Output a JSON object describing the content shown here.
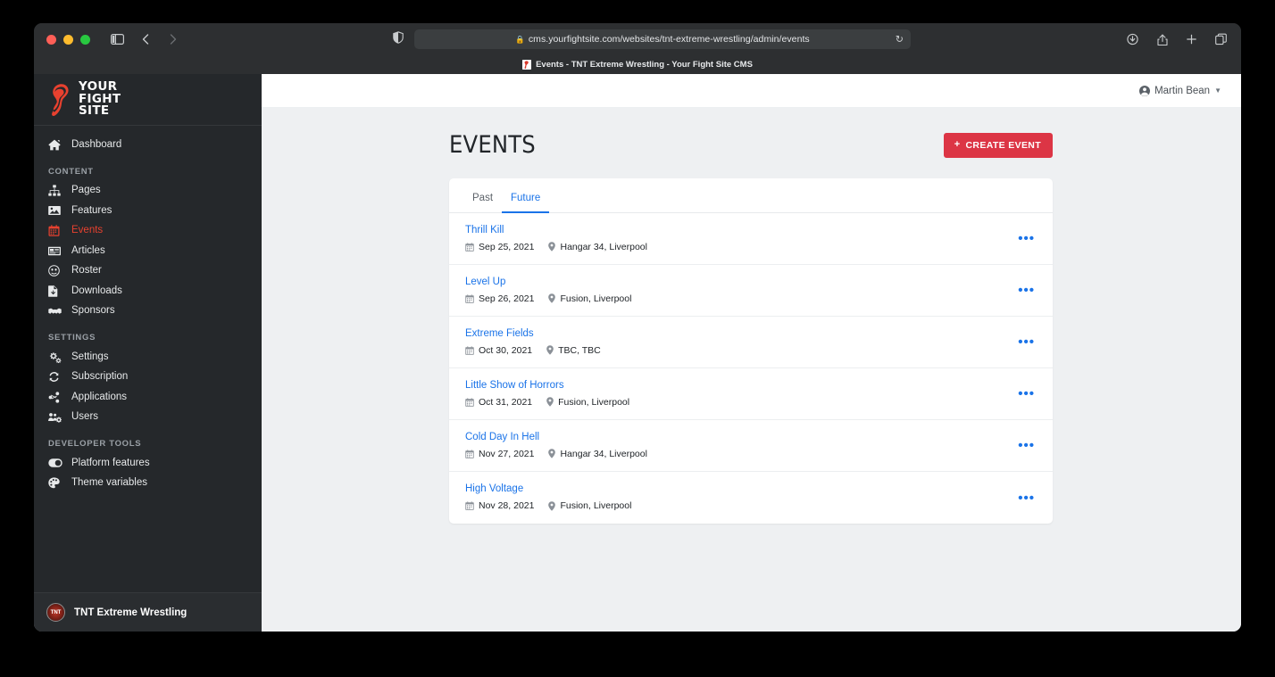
{
  "browser": {
    "url": "cms.yourfightsite.com/websites/tnt-extreme-wrestling/admin/events",
    "tab_title": "Events - TNT Extreme Wrestling - Your Fight Site CMS",
    "lock_icon": "lock-icon",
    "reload_icon": "reload-icon",
    "back_icon": "back-arrow-icon",
    "forward_icon": "forward-arrow-icon",
    "sidebar_icon": "sidebar-toggle-icon",
    "shield_icon": "shield-icon",
    "downloads_icon": "downloads-icon",
    "share_icon": "share-icon",
    "newtab_icon": "new-tab-icon",
    "tabs_icon": "tab-overview-icon"
  },
  "sidebar": {
    "brand": {
      "line1": "YOUR",
      "line2": "FIGHT",
      "line3": "SITE",
      "logo_icon": "fist-logo-icon"
    },
    "groups": [
      {
        "heading": null,
        "items": [
          {
            "label": "Dashboard",
            "icon": "home-icon",
            "active": false
          }
        ]
      },
      {
        "heading": "CONTENT",
        "items": [
          {
            "label": "Pages",
            "icon": "sitemap-icon",
            "active": false
          },
          {
            "label": "Features",
            "icon": "image-icon",
            "active": false
          },
          {
            "label": "Events",
            "icon": "calendar-icon",
            "active": true
          },
          {
            "label": "Articles",
            "icon": "newspaper-icon",
            "active": false
          },
          {
            "label": "Roster",
            "icon": "mask-icon",
            "active": false
          },
          {
            "label": "Downloads",
            "icon": "file-download-icon",
            "active": false
          },
          {
            "label": "Sponsors",
            "icon": "handshake-icon",
            "active": false
          }
        ]
      },
      {
        "heading": "SETTINGS",
        "items": [
          {
            "label": "Settings",
            "icon": "cogs-icon",
            "active": false
          },
          {
            "label": "Subscription",
            "icon": "sync-icon",
            "active": false
          },
          {
            "label": "Applications",
            "icon": "share-alt-icon",
            "active": false
          },
          {
            "label": "Users",
            "icon": "users-cog-icon",
            "active": false
          }
        ]
      },
      {
        "heading": "DEVELOPER TOOLS",
        "items": [
          {
            "label": "Platform features",
            "icon": "toggle-on-icon",
            "active": false
          },
          {
            "label": "Theme variables",
            "icon": "palette-icon",
            "active": false
          }
        ]
      }
    ],
    "footer": {
      "site_name": "TNT Extreme Wrestling",
      "avatar_text": "TNT",
      "avatar_icon": "tnt-logo-avatar"
    }
  },
  "topbar": {
    "user_name": "Martin Bean",
    "user_icon": "user-circle-icon",
    "caret_icon": "caret-down-icon"
  },
  "page": {
    "title": "EVENTS",
    "create_button": {
      "label": "CREATE EVENT",
      "icon": "plus-icon"
    },
    "tabs": [
      {
        "label": "Past",
        "active": false
      },
      {
        "label": "Future",
        "active": true
      }
    ],
    "row_menu_icon": "ellipsis-horizontal-icon",
    "events": [
      {
        "title": "Thrill Kill",
        "date": "Sep 25, 2021",
        "venue": "Hangar 34, Liverpool"
      },
      {
        "title": "Level Up",
        "date": "Sep 26, 2021",
        "venue": "Fusion, Liverpool"
      },
      {
        "title": "Extreme Fields",
        "date": "Oct 30, 2021",
        "venue": "TBC, TBC"
      },
      {
        "title": "Little Show of Horrors",
        "date": "Oct 31, 2021",
        "venue": "Fusion, Liverpool"
      },
      {
        "title": "Cold Day In Hell",
        "date": "Nov 27, 2021",
        "venue": "Hangar 34, Liverpool"
      },
      {
        "title": "High Voltage",
        "date": "Nov 28, 2021",
        "venue": "Fusion, Liverpool"
      }
    ],
    "date_icon": "calendar-alt-icon",
    "venue_icon": "map-marker-icon"
  },
  "colors": {
    "accent_red": "#dc3545",
    "link_blue": "#1a73e8",
    "sidebar_bg": "#25282b",
    "page_bg": "#eef0f2"
  }
}
